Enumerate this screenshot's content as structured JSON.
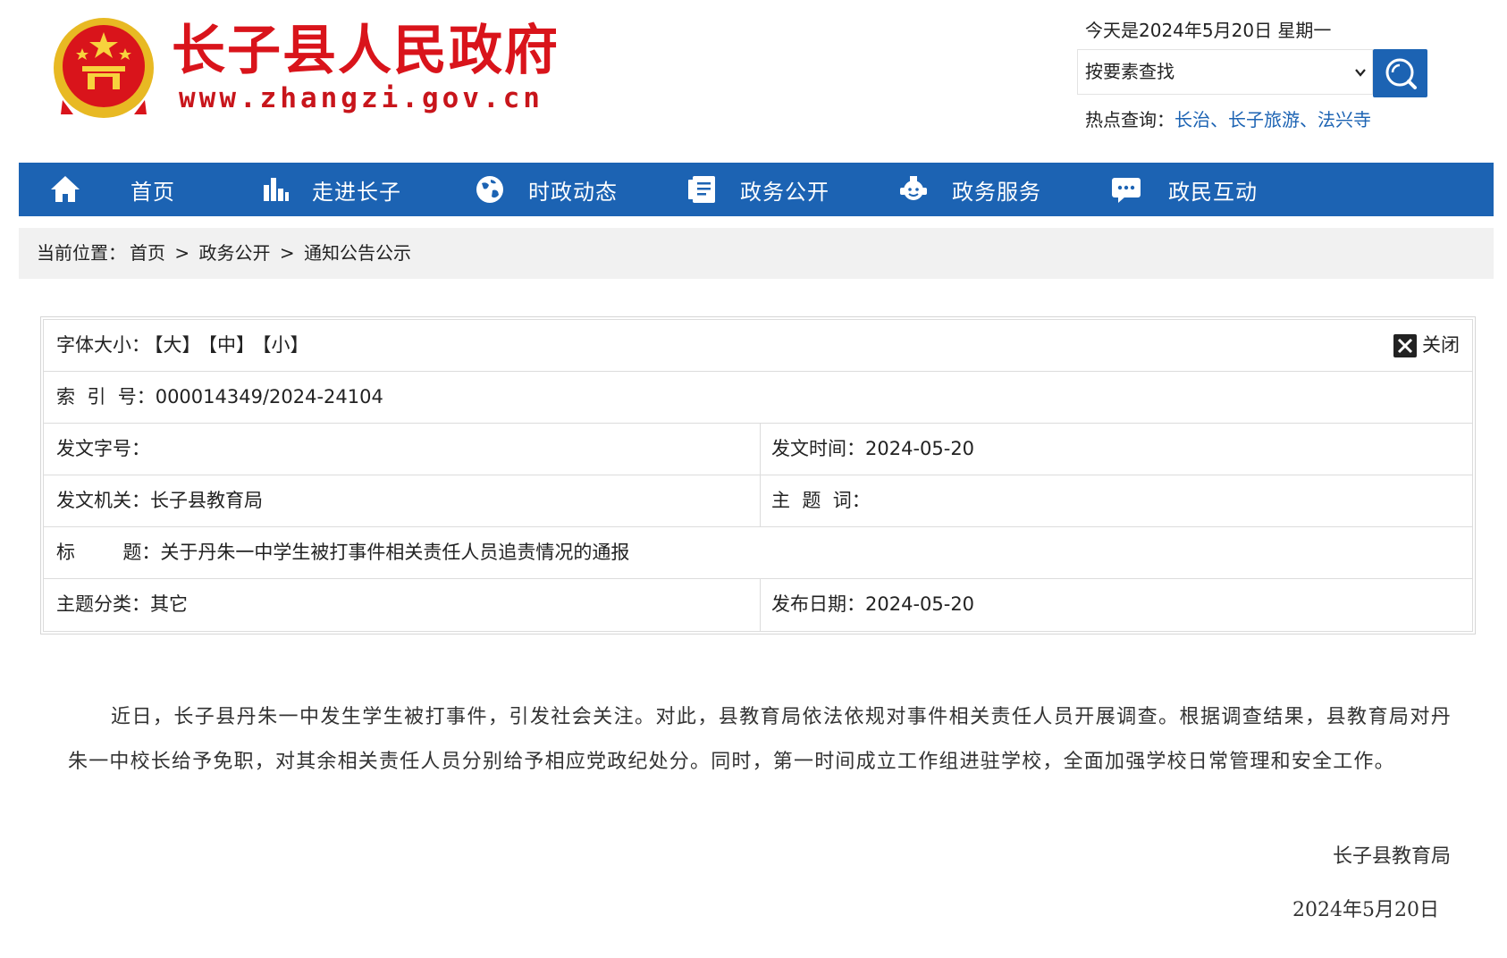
{
  "header": {
    "site_title": "长子县人民政府",
    "site_url": "www.zhangzi.gov.cn",
    "today": "今天是2024年5月20日 星期一",
    "search": {
      "select_value": "按要素查找"
    },
    "hot": {
      "label": "热点查询：",
      "links": [
        "长治",
        "长子旅游",
        "法兴寺"
      ],
      "separator": "、"
    }
  },
  "nav": {
    "items": [
      {
        "label": "首页",
        "icon": "home-icon"
      },
      {
        "label": "走进长子",
        "icon": "chart-icon"
      },
      {
        "label": "时政动态",
        "icon": "globe-icon"
      },
      {
        "label": "政务公开",
        "icon": "document-icon"
      },
      {
        "label": "政务服务",
        "icon": "service-icon"
      },
      {
        "label": "政民互动",
        "icon": "chat-icon"
      }
    ]
  },
  "breadcrumb": {
    "prefix": "当前位置：",
    "items": [
      "首页",
      "政务公开",
      "通知公告公示"
    ],
    "separator": ">"
  },
  "info": {
    "font_size_label": "字体大小：",
    "font_sizes": [
      "【大】",
      "【中】",
      "【小】"
    ],
    "close_label": "关闭",
    "index_label": "索  引  号：",
    "index_value": "000014349/2024-24104",
    "doc_no_label": "发文字号：",
    "doc_no_value": "",
    "issue_time_label": "发文时间：",
    "issue_time_value": "2024-05-20",
    "issuer_label": "发文机关：",
    "issuer_value": "长子县教育局",
    "keywords_label": "主  题  词：",
    "keywords_value": "",
    "title_label": "标        题：",
    "title_value": "关于丹朱一中学生被打事件相关责任人员追责情况的通报",
    "category_label": "主题分类：",
    "category_value": "其它",
    "publish_date_label": "发布日期：",
    "publish_date_value": "2024-05-20"
  },
  "article": {
    "body": "近日，长子县丹朱一中发生学生被打事件，引发社会关注。对此，县教育局依法依规对事件相关责任人员开展调查。根据调查结果，县教育局对丹朱一中校长给予免职，对其余相关责任人员分别给予相应党政纪处分。同时，第一时间成立工作组进驻学校，全面加强学校日常管理和安全工作。",
    "signature": "长子县教育局",
    "date": "2024年5月20日"
  },
  "colors": {
    "brand_red": "#d9141b",
    "nav_blue": "#1c63b3",
    "link_blue": "#1c63b3"
  }
}
